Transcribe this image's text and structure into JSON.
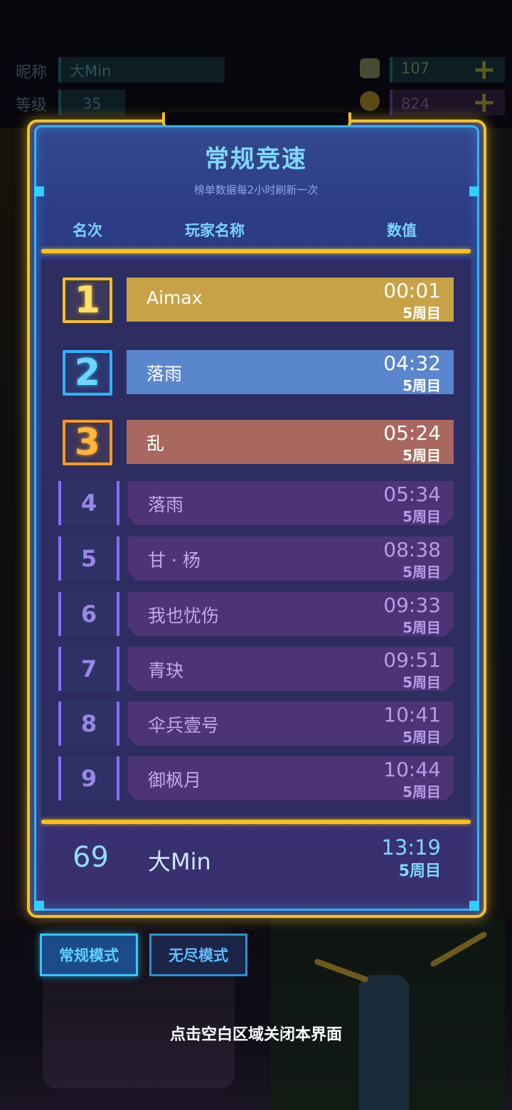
{
  "top_bar": {
    "nickname_label": "昵称",
    "nickname_value": "大Min",
    "level_label": "等级",
    "level_value": "35",
    "currency1_value": "107",
    "currency2_value": "824",
    "plus_symbol": "+",
    "currency1_icon": "gem-chip-icon",
    "currency2_icon": "demon-face-icon"
  },
  "leaderboard": {
    "title": "常规竞速",
    "subtitle": "榜单数据每2小时刷新一次",
    "columns": {
      "rank": "名次",
      "player": "玩家名称",
      "value": "数值"
    },
    "entries": [
      {
        "rank": "1",
        "name": "Aimax",
        "time": "00:01",
        "cycle": "5周目"
      },
      {
        "rank": "2",
        "name": "落雨",
        "time": "04:32",
        "cycle": "5周目"
      },
      {
        "rank": "3",
        "name": "乱",
        "time": "05:24",
        "cycle": "5周目"
      },
      {
        "rank": "4",
        "name": "落雨",
        "time": "05:34",
        "cycle": "5周目"
      },
      {
        "rank": "5",
        "name": "甘 · 杨",
        "time": "08:38",
        "cycle": "5周目"
      },
      {
        "rank": "6",
        "name": "我也忧伤",
        "time": "09:33",
        "cycle": "5周目"
      },
      {
        "rank": "7",
        "name": "青玦",
        "time": "09:51",
        "cycle": "5周目"
      },
      {
        "rank": "8",
        "name": "伞兵壹号",
        "time": "10:41",
        "cycle": "5周目"
      },
      {
        "rank": "9",
        "name": "御枫月",
        "time": "10:44",
        "cycle": "5周目"
      }
    ],
    "self": {
      "rank": "69",
      "name": "大Min",
      "time": "13:19",
      "cycle": "5周目"
    }
  },
  "modes": {
    "normal_label": "常规模式",
    "endless_label": "无尽模式",
    "active": "常规模式"
  },
  "close_hint": "点击空白区域关闭本界面",
  "colors": {
    "frame_gold": "#f6c21a",
    "frame_cyan": "#2fb4ff",
    "rank1_bar": "#c8a247",
    "rank2_bar": "#5a86cd",
    "rank3_bar": "#a8685f",
    "rank_other_bar": "#4c3476"
  }
}
